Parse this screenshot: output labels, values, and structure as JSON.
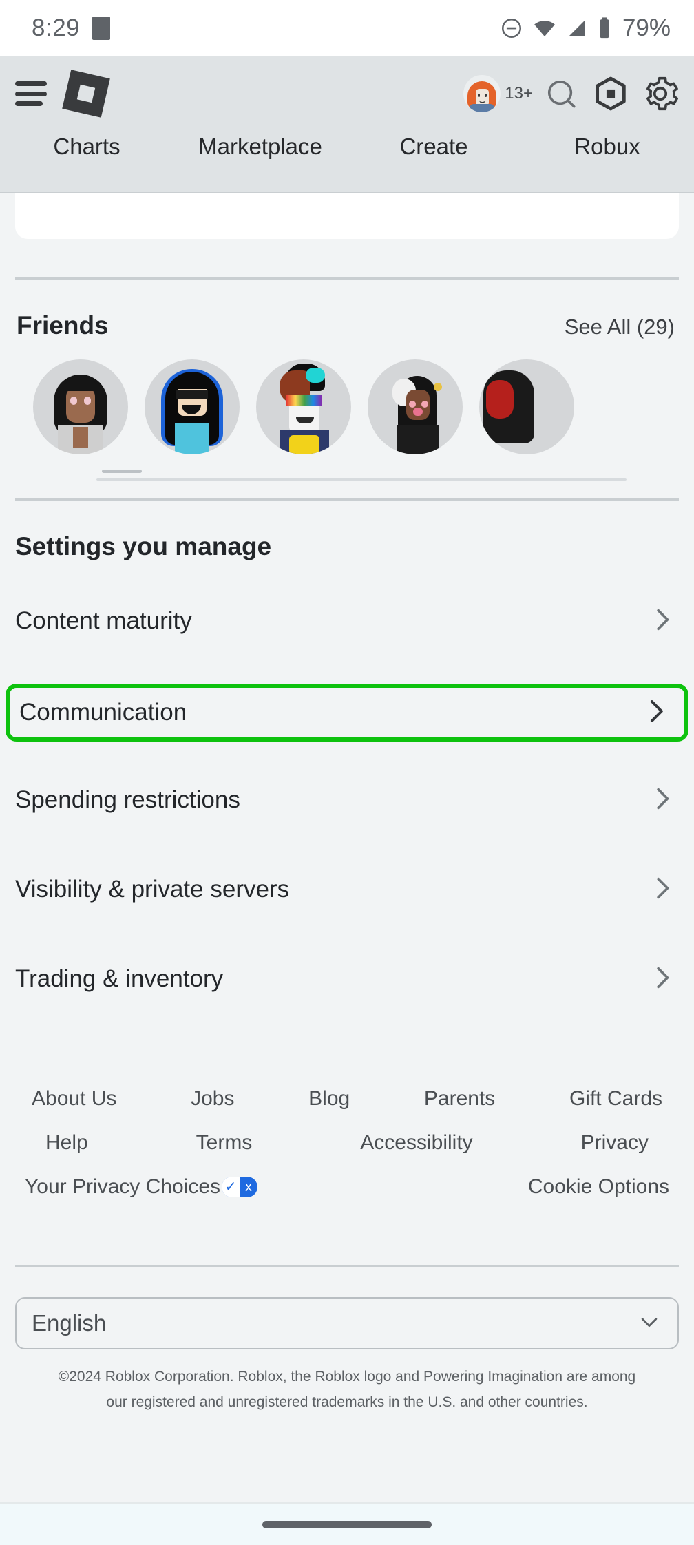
{
  "status_bar": {
    "time": "8:29",
    "battery_percent": "79%",
    "icons": [
      "notification-square-icon",
      "do-not-disturb-icon",
      "wifi-icon",
      "cellular-signal-icon",
      "battery-icon"
    ]
  },
  "app_bar": {
    "menu_icon": "hamburger-menu-icon",
    "logo": "roblox-logo-icon",
    "avatar_age_badge": "13+",
    "icons": [
      "search-icon",
      "robux-icon",
      "settings-gear-icon"
    ],
    "tabs": [
      {
        "label": "Charts"
      },
      {
        "label": "Marketplace"
      },
      {
        "label": "Create"
      },
      {
        "label": "Robux"
      }
    ]
  },
  "friends": {
    "title": "Friends",
    "see_all": "See All (29)",
    "avatars": [
      {
        "name": "friend-avatar-1"
      },
      {
        "name": "friend-avatar-2"
      },
      {
        "name": "friend-avatar-3"
      },
      {
        "name": "friend-avatar-4"
      },
      {
        "name": "friend-avatar-5"
      }
    ]
  },
  "settings_section": {
    "title": "Settings you manage",
    "highlight_color": "#0ec20e",
    "rows": [
      {
        "label": "Content maturity",
        "highlighted": false
      },
      {
        "label": "Communication",
        "highlighted": true
      },
      {
        "label": "Spending restrictions",
        "highlighted": false
      },
      {
        "label": "Visibility & private servers",
        "highlighted": false
      },
      {
        "label": "Trading & inventory",
        "highlighted": false
      }
    ]
  },
  "footer": {
    "row1": [
      "About Us",
      "Jobs",
      "Blog",
      "Parents",
      "Gift Cards"
    ],
    "row2": [
      "Help",
      "Terms",
      "Accessibility",
      "Privacy"
    ],
    "privacy_choices": "Your Privacy Choices",
    "privacy_icon_check": "✓",
    "privacy_icon_x": "x",
    "cookie_options": "Cookie Options",
    "language": "English",
    "copyright": "©2024 Roblox Corporation. Roblox, the Roblox logo and Powering Imagination are among our registered and unregistered trademarks in the U.S. and other countries."
  }
}
